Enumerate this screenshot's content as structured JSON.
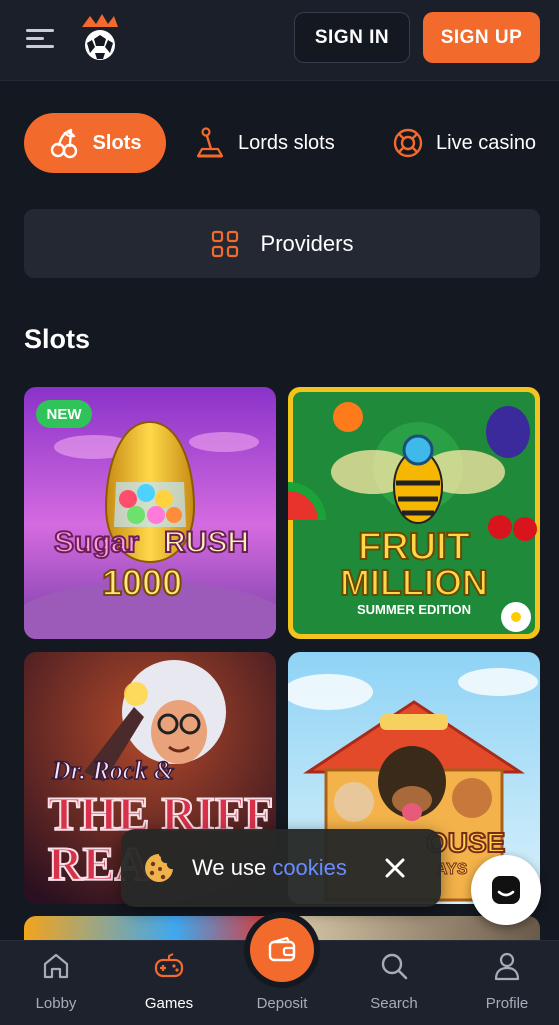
{
  "header": {
    "sign_in_label": "SIGN IN",
    "sign_up_label": "SIGN UP"
  },
  "categories": [
    {
      "label": "Slots",
      "icon": "cherries-icon",
      "active": true
    },
    {
      "label": "Lords slots",
      "icon": "joystick-icon",
      "active": false
    },
    {
      "label": "Live casino",
      "icon": "lifebuoy-icon",
      "active": false
    }
  ],
  "providers": {
    "label": "Providers",
    "icon": "grid-icon"
  },
  "section": {
    "title": "Slots"
  },
  "games": [
    {
      "logo_text": [
        "Sugar",
        "RUSH",
        "1000"
      ],
      "badge": "NEW"
    },
    {
      "logo_text": [
        "FRUIT",
        "MILLION",
        "SUMMER EDITION"
      ],
      "badge": ""
    },
    {
      "logo_text": [
        "Dr. Rock &",
        "THE RIFF",
        "REA"
      ],
      "badge": ""
    },
    {
      "logo_text": [
        "OUSE",
        "AYS"
      ],
      "badge": ""
    }
  ],
  "cookie_banner": {
    "prefix": "We use",
    "link": "cookies"
  },
  "bottom_nav": [
    {
      "label": "Lobby",
      "icon": "home-icon",
      "active": false
    },
    {
      "label": "Games",
      "icon": "gamepad-icon",
      "active": true
    },
    {
      "label": "Deposit",
      "icon": "wallet-icon",
      "active": false
    },
    {
      "label": "Search",
      "icon": "search-icon",
      "active": false
    },
    {
      "label": "Profile",
      "icon": "user-icon",
      "active": false
    }
  ],
  "colors": {
    "accent": "#f36a2d",
    "background": "#141821",
    "panel": "#232833",
    "new_badge": "#30c35a",
    "link": "#6b8cff"
  }
}
